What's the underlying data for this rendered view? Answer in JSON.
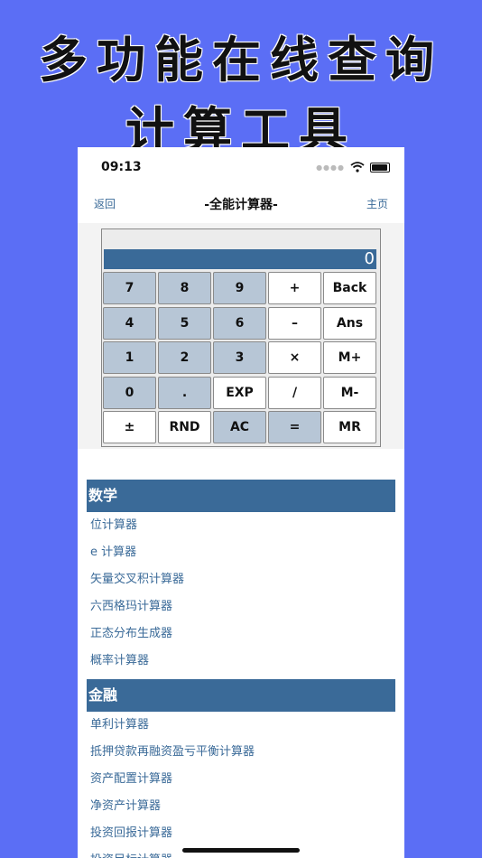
{
  "headline": {
    "line1": "多功能在线查询",
    "line2": "计算工具"
  },
  "statusbar": {
    "time": "09:13"
  },
  "navbar": {
    "back": "返回",
    "title": "-全能计算器-",
    "home": "主页"
  },
  "calculator": {
    "display": "0",
    "keys": [
      {
        "label": "7",
        "style": "shaded"
      },
      {
        "label": "8",
        "style": "shaded"
      },
      {
        "label": "9",
        "style": "shaded"
      },
      {
        "label": "+",
        "style": "plain"
      },
      {
        "label": "Back",
        "style": "plain"
      },
      {
        "label": "4",
        "style": "shaded"
      },
      {
        "label": "5",
        "style": "shaded"
      },
      {
        "label": "6",
        "style": "shaded"
      },
      {
        "label": "–",
        "style": "plain"
      },
      {
        "label": "Ans",
        "style": "plain"
      },
      {
        "label": "1",
        "style": "shaded"
      },
      {
        "label": "2",
        "style": "shaded"
      },
      {
        "label": "3",
        "style": "shaded"
      },
      {
        "label": "×",
        "style": "plain"
      },
      {
        "label": "M+",
        "style": "plain"
      },
      {
        "label": "0",
        "style": "shaded"
      },
      {
        "label": ".",
        "style": "shaded"
      },
      {
        "label": "EXP",
        "style": "plain"
      },
      {
        "label": "/",
        "style": "plain"
      },
      {
        "label": "M-",
        "style": "plain"
      },
      {
        "label": "±",
        "style": "plain"
      },
      {
        "label": "RND",
        "style": "plain"
      },
      {
        "label": "AC",
        "style": "shaded"
      },
      {
        "label": "=",
        "style": "shaded"
      },
      {
        "label": "MR",
        "style": "plain"
      }
    ]
  },
  "sections": [
    {
      "title": "数学",
      "items": [
        "位计算器",
        "e 计算器",
        "矢量交叉积计算器",
        "六西格玛计算器",
        "正态分布生成器",
        "概率计算器"
      ]
    },
    {
      "title": "金融",
      "items": [
        "单利计算器",
        "抵押贷款再融资盈亏平衡计算器",
        "资产配置计算器",
        "净资产计算器",
        "投资回报计算器",
        "投资目标计算器"
      ]
    }
  ],
  "colors": {
    "background": "#5b6ef5",
    "accent": "#3a6a98",
    "key_shaded": "#b7c6d6"
  }
}
